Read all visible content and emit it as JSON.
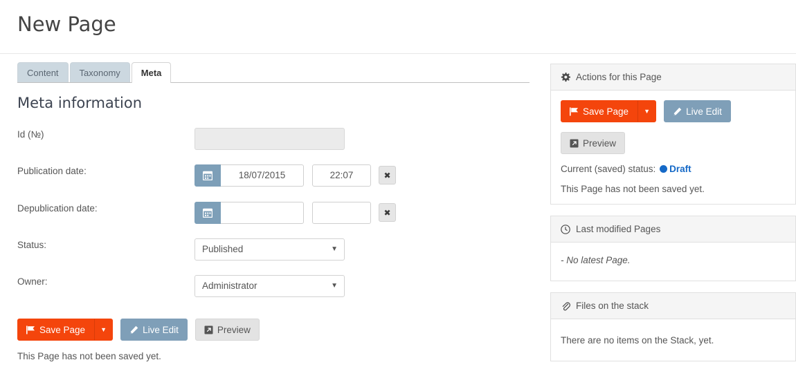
{
  "header": {
    "title": "New Page"
  },
  "tabs": [
    {
      "label": "Content",
      "active": false
    },
    {
      "label": "Taxonomy",
      "active": false
    },
    {
      "label": "Meta",
      "active": true
    }
  ],
  "form": {
    "section_title": "Meta information",
    "fields": {
      "id_label": "Id (№)",
      "id_value": "",
      "publication_label": "Publication date:",
      "publication_date": "18/07/2015",
      "publication_time": "22:07",
      "depublication_label": "Depublication date:",
      "depublication_date": "",
      "depublication_time": "",
      "status_label": "Status:",
      "status_value": "Published",
      "owner_label": "Owner:",
      "owner_value": "Administrator"
    }
  },
  "actions": {
    "save_label": "Save Page",
    "live_edit_label": "Live Edit",
    "preview_label": "Preview",
    "not_saved_note": "This Page has not been saved yet."
  },
  "sidebar": {
    "actions_panel": {
      "title": "Actions for this Page",
      "icon": "gear-icon",
      "save_label": "Save Page",
      "live_edit_label": "Live Edit",
      "preview_label": "Preview",
      "status_prefix": "Current (saved) status:",
      "status_value": "Draft",
      "not_saved_note": "This Page has not been saved yet."
    },
    "last_modified_panel": {
      "title": "Last modified Pages",
      "icon": "clock-icon",
      "empty_text": "- No latest Page."
    },
    "files_panel": {
      "title": "Files on the stack",
      "icon": "paperclip-icon",
      "empty_text": "There are no items on the Stack, yet."
    }
  },
  "colors": {
    "orange": "#f4450c",
    "blue": "#7f9fb8",
    "draft_blue": "#1569c7",
    "tab_inactive": "#ccd8e0"
  }
}
